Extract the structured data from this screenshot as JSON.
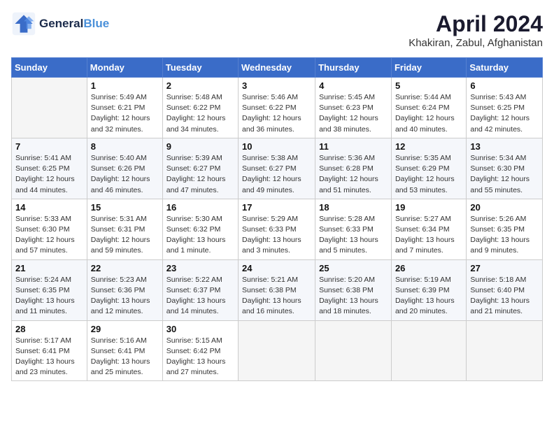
{
  "header": {
    "logo_line1": "General",
    "logo_line2": "Blue",
    "month": "April 2024",
    "location": "Khakiran, Zabul, Afghanistan"
  },
  "days_of_week": [
    "Sunday",
    "Monday",
    "Tuesday",
    "Wednesday",
    "Thursday",
    "Friday",
    "Saturday"
  ],
  "weeks": [
    [
      {
        "day": "",
        "info": ""
      },
      {
        "day": "1",
        "info": "Sunrise: 5:49 AM\nSunset: 6:21 PM\nDaylight: 12 hours\nand 32 minutes."
      },
      {
        "day": "2",
        "info": "Sunrise: 5:48 AM\nSunset: 6:22 PM\nDaylight: 12 hours\nand 34 minutes."
      },
      {
        "day": "3",
        "info": "Sunrise: 5:46 AM\nSunset: 6:22 PM\nDaylight: 12 hours\nand 36 minutes."
      },
      {
        "day": "4",
        "info": "Sunrise: 5:45 AM\nSunset: 6:23 PM\nDaylight: 12 hours\nand 38 minutes."
      },
      {
        "day": "5",
        "info": "Sunrise: 5:44 AM\nSunset: 6:24 PM\nDaylight: 12 hours\nand 40 minutes."
      },
      {
        "day": "6",
        "info": "Sunrise: 5:43 AM\nSunset: 6:25 PM\nDaylight: 12 hours\nand 42 minutes."
      }
    ],
    [
      {
        "day": "7",
        "info": "Sunrise: 5:41 AM\nSunset: 6:25 PM\nDaylight: 12 hours\nand 44 minutes."
      },
      {
        "day": "8",
        "info": "Sunrise: 5:40 AM\nSunset: 6:26 PM\nDaylight: 12 hours\nand 46 minutes."
      },
      {
        "day": "9",
        "info": "Sunrise: 5:39 AM\nSunset: 6:27 PM\nDaylight: 12 hours\nand 47 minutes."
      },
      {
        "day": "10",
        "info": "Sunrise: 5:38 AM\nSunset: 6:27 PM\nDaylight: 12 hours\nand 49 minutes."
      },
      {
        "day": "11",
        "info": "Sunrise: 5:36 AM\nSunset: 6:28 PM\nDaylight: 12 hours\nand 51 minutes."
      },
      {
        "day": "12",
        "info": "Sunrise: 5:35 AM\nSunset: 6:29 PM\nDaylight: 12 hours\nand 53 minutes."
      },
      {
        "day": "13",
        "info": "Sunrise: 5:34 AM\nSunset: 6:30 PM\nDaylight: 12 hours\nand 55 minutes."
      }
    ],
    [
      {
        "day": "14",
        "info": "Sunrise: 5:33 AM\nSunset: 6:30 PM\nDaylight: 12 hours\nand 57 minutes."
      },
      {
        "day": "15",
        "info": "Sunrise: 5:31 AM\nSunset: 6:31 PM\nDaylight: 12 hours\nand 59 minutes."
      },
      {
        "day": "16",
        "info": "Sunrise: 5:30 AM\nSunset: 6:32 PM\nDaylight: 13 hours\nand 1 minute."
      },
      {
        "day": "17",
        "info": "Sunrise: 5:29 AM\nSunset: 6:33 PM\nDaylight: 13 hours\nand 3 minutes."
      },
      {
        "day": "18",
        "info": "Sunrise: 5:28 AM\nSunset: 6:33 PM\nDaylight: 13 hours\nand 5 minutes."
      },
      {
        "day": "19",
        "info": "Sunrise: 5:27 AM\nSunset: 6:34 PM\nDaylight: 13 hours\nand 7 minutes."
      },
      {
        "day": "20",
        "info": "Sunrise: 5:26 AM\nSunset: 6:35 PM\nDaylight: 13 hours\nand 9 minutes."
      }
    ],
    [
      {
        "day": "21",
        "info": "Sunrise: 5:24 AM\nSunset: 6:35 PM\nDaylight: 13 hours\nand 11 minutes."
      },
      {
        "day": "22",
        "info": "Sunrise: 5:23 AM\nSunset: 6:36 PM\nDaylight: 13 hours\nand 12 minutes."
      },
      {
        "day": "23",
        "info": "Sunrise: 5:22 AM\nSunset: 6:37 PM\nDaylight: 13 hours\nand 14 minutes."
      },
      {
        "day": "24",
        "info": "Sunrise: 5:21 AM\nSunset: 6:38 PM\nDaylight: 13 hours\nand 16 minutes."
      },
      {
        "day": "25",
        "info": "Sunrise: 5:20 AM\nSunset: 6:38 PM\nDaylight: 13 hours\nand 18 minutes."
      },
      {
        "day": "26",
        "info": "Sunrise: 5:19 AM\nSunset: 6:39 PM\nDaylight: 13 hours\nand 20 minutes."
      },
      {
        "day": "27",
        "info": "Sunrise: 5:18 AM\nSunset: 6:40 PM\nDaylight: 13 hours\nand 21 minutes."
      }
    ],
    [
      {
        "day": "28",
        "info": "Sunrise: 5:17 AM\nSunset: 6:41 PM\nDaylight: 13 hours\nand 23 minutes."
      },
      {
        "day": "29",
        "info": "Sunrise: 5:16 AM\nSunset: 6:41 PM\nDaylight: 13 hours\nand 25 minutes."
      },
      {
        "day": "30",
        "info": "Sunrise: 5:15 AM\nSunset: 6:42 PM\nDaylight: 13 hours\nand 27 minutes."
      },
      {
        "day": "",
        "info": ""
      },
      {
        "day": "",
        "info": ""
      },
      {
        "day": "",
        "info": ""
      },
      {
        "day": "",
        "info": ""
      }
    ]
  ]
}
